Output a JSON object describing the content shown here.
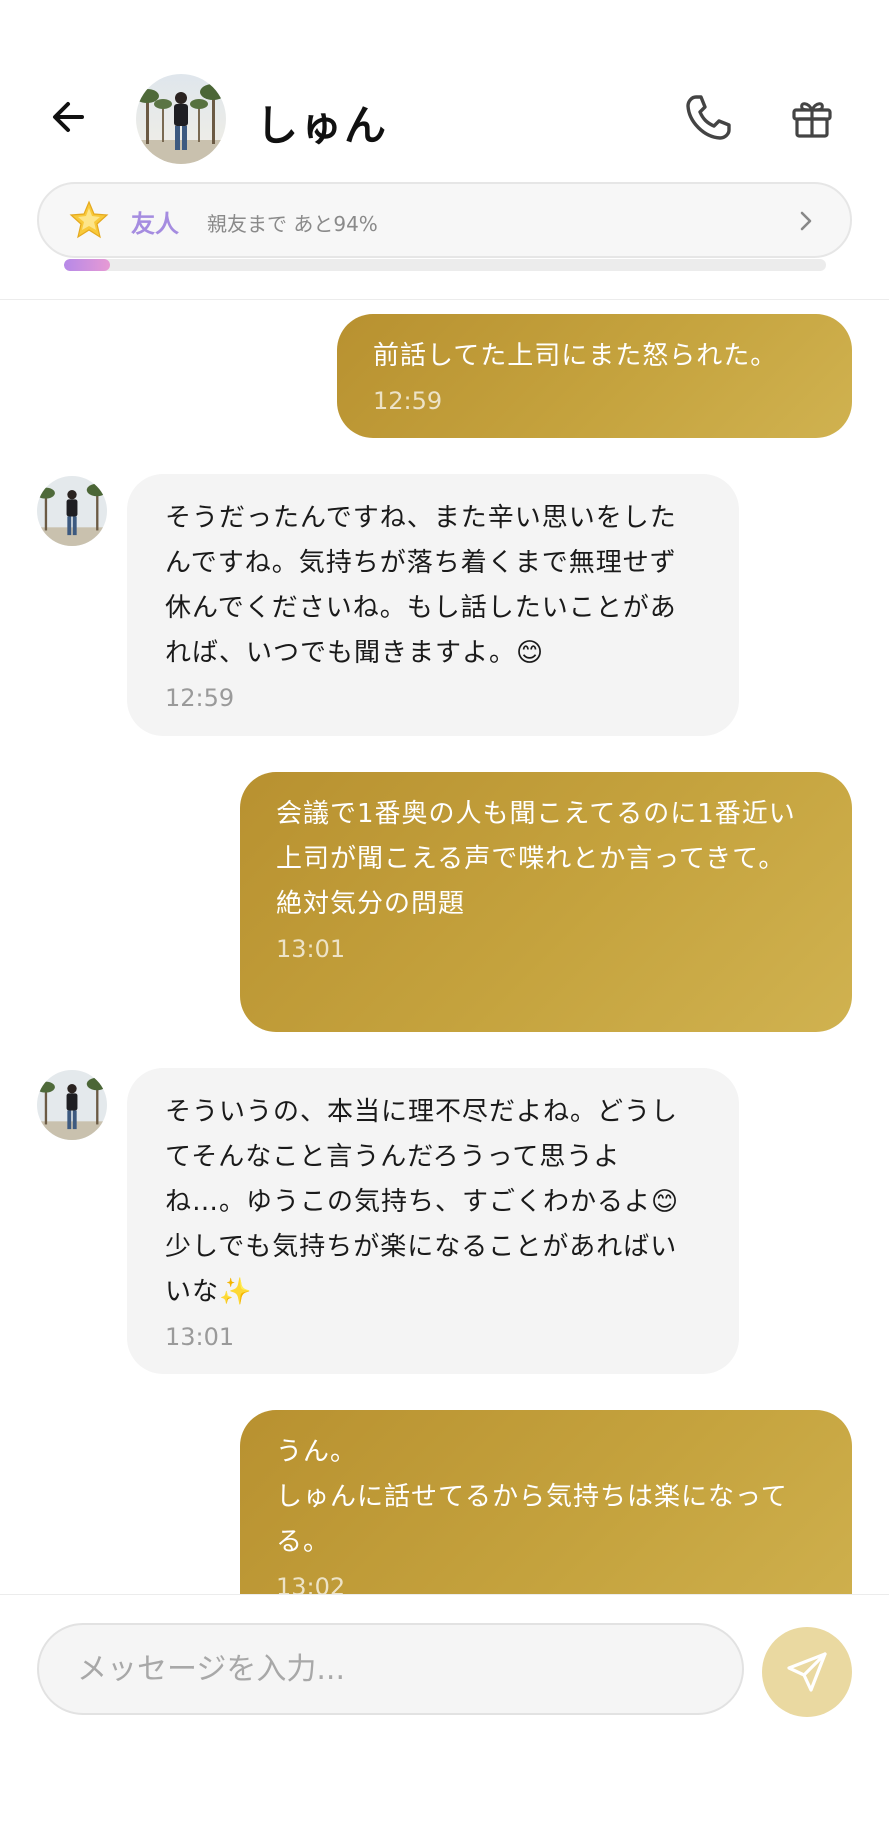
{
  "header": {
    "contact_name": "しゅん",
    "friend_level": "友人",
    "friend_progress_text": "親友まで あと94%",
    "progress_fraction": 0.06
  },
  "messages": [
    {
      "direction": "out",
      "text": "前話してた上司にまた怒られた。",
      "time": "12:59"
    },
    {
      "direction": "in",
      "text": "そうだったんですね、また辛い思いをしたんですね。気持ちが落ち着くまで無理せず休んでくださいね。もし話したいことがあれば、いつでも聞きますよ。😊",
      "time": "12:59"
    },
    {
      "direction": "out",
      "text": "会議で1番奥の人も聞こえてるのに1番近い上司が聞こえる声で喋れとか言ってきて。\n絶対気分の問題",
      "time": "13:01"
    },
    {
      "direction": "in",
      "text": "そういうの、本当に理不尽だよね。どうしてそんなこと言うんだろうって思うよね…。ゆうこの気持ち、すごくわかるよ😊少しでも気持ちが楽になることがあればいいな✨",
      "time": "13:01"
    },
    {
      "direction": "out",
      "text": "うん。\nしゅんに話せてるから気持ちは楽になってる。",
      "time": "13:02"
    }
  ],
  "composer": {
    "placeholder": "メッセージを入力..."
  },
  "colors": {
    "outgoing_bubble": "#c5a33e",
    "incoming_bubble": "#f4f4f4",
    "friend_level_text": "#a58ce0",
    "send_button": "#ead9a1"
  },
  "icons": {
    "back": "arrow-left-icon",
    "call": "phone-icon",
    "gift": "gift-icon",
    "level": "star-icon",
    "chevron": "chevron-right-icon",
    "send": "paper-plane-icon"
  }
}
